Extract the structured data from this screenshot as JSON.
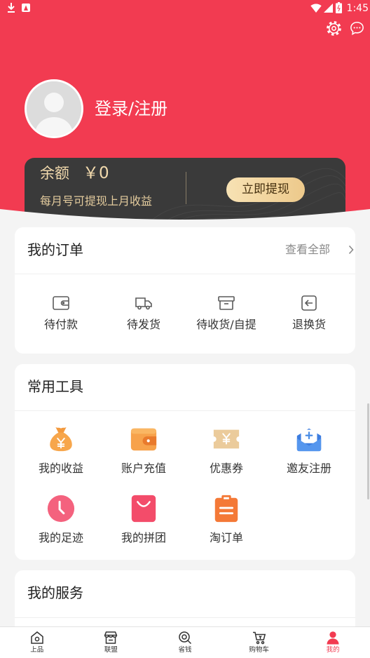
{
  "colors": {
    "primary_red": "#f23b51",
    "balance_card": "#3a3a3a",
    "gold_text": "#f2daad",
    "page_bg": "#f4f4f4"
  },
  "status_bar": {
    "time": "1:45",
    "left_icons": [
      "download-icon",
      "app-notification-icon"
    ],
    "right_icons": [
      "wifi-icon",
      "signal-icon",
      "battery-icon"
    ]
  },
  "header": {
    "login_label": "登录/注册",
    "icons": [
      "settings-icon",
      "message-icon"
    ]
  },
  "balance": {
    "label": "余额",
    "amount": "￥0",
    "note": "每月号可提现上月收益",
    "withdraw_button": "立即提现"
  },
  "orders": {
    "title": "我的订单",
    "view_all": "查看全部",
    "items": [
      {
        "label": "待付款",
        "icon": "wallet-icon"
      },
      {
        "label": "待发货",
        "icon": "truck-icon"
      },
      {
        "label": "待收货/自提",
        "icon": "package-icon"
      },
      {
        "label": "退换货",
        "icon": "return-icon"
      }
    ]
  },
  "tools": {
    "title": "常用工具",
    "items": [
      {
        "label": "我的收益",
        "icon": "money-bag-icon"
      },
      {
        "label": "账户充值",
        "icon": "wallet-icon"
      },
      {
        "label": "优惠券",
        "icon": "coupon-icon"
      },
      {
        "label": "邀友注册",
        "icon": "invite-envelope-icon"
      },
      {
        "label": "我的足迹",
        "icon": "clock-icon"
      },
      {
        "label": "我的拼团",
        "icon": "shopping-bag-icon"
      },
      {
        "label": "淘订单",
        "icon": "clipboard-icon"
      }
    ]
  },
  "services": {
    "title": "我的服务"
  },
  "tabbar": {
    "active_index": 4,
    "items": [
      {
        "label": "上品",
        "icon": "home-icon"
      },
      {
        "label": "联盟",
        "icon": "store-icon"
      },
      {
        "label": "省钱",
        "icon": "search-icon"
      },
      {
        "label": "购物车",
        "icon": "cart-icon"
      },
      {
        "label": "我的",
        "icon": "user-icon"
      }
    ]
  }
}
